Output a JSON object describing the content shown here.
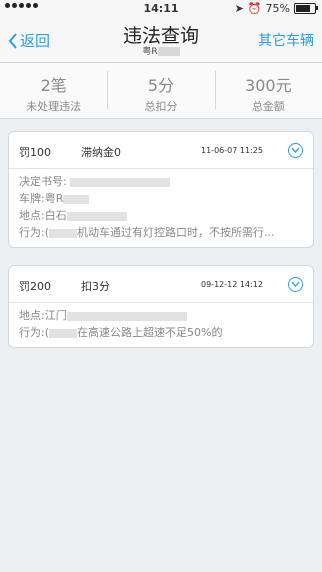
{
  "status_bar": {
    "time": "14:11",
    "battery": "75%",
    "battery_level": 0.75
  },
  "nav": {
    "back_label": "返回",
    "title": "违法查询",
    "plate_prefix": "粤R",
    "other_label": "其它车辆"
  },
  "summary": [
    {
      "value": "2笔",
      "label": "未处理违法"
    },
    {
      "value": "5分",
      "label": "总扣分"
    },
    {
      "value": "300元",
      "label": "总金额"
    }
  ],
  "records": [
    {
      "fine": "罚100",
      "extra": "滞纳金0",
      "date": "11-06-07 11:25",
      "fields": {
        "decision_label": "决定书号:",
        "plate_label": "车牌:",
        "plate_prefix": "粤R",
        "location_label": "地点:",
        "location_prefix": "白石",
        "action_label": "行为:",
        "action_prefix": "(",
        "action_text": "机动车通过有灯控路口时，不按所需行..."
      }
    },
    {
      "fine": "罚200",
      "extra": "扣3分",
      "date": "09-12-12 14:12",
      "fields": {
        "location_label": "地点:",
        "location_prefix": "江门",
        "action_label": "行为:",
        "action_prefix": "(",
        "action_text": "在高速公路上超速不足50%的"
      }
    }
  ]
}
